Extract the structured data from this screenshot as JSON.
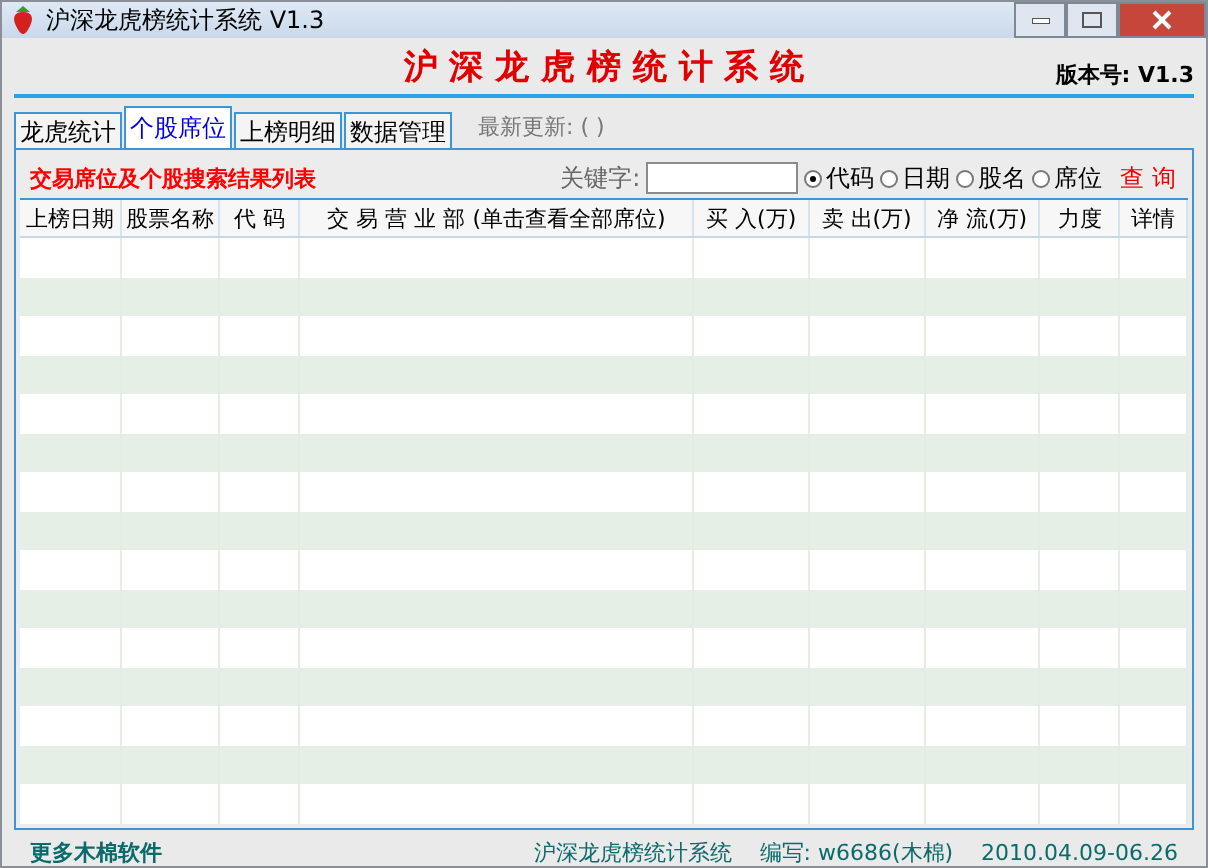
{
  "window": {
    "title": "沪深龙虎榜统计系统 V1.3"
  },
  "header": {
    "title": "沪 深 龙 虎 榜 统 计 系 统",
    "version": "版本号: V1.3"
  },
  "tabs": [
    {
      "label": "龙虎统计",
      "selected": false
    },
    {
      "label": "个股席位",
      "selected": true
    },
    {
      "label": "上榜明细",
      "selected": false
    },
    {
      "label": "数据管理",
      "selected": false
    }
  ],
  "last_update": "最新更新: ( )",
  "panel": {
    "heading": "交易席位及个股搜索结果列表",
    "keyword_label": "关键字:",
    "search_by": [
      {
        "label": "代码",
        "selected": true
      },
      {
        "label": "日期",
        "selected": false
      },
      {
        "label": "股名",
        "selected": false
      },
      {
        "label": "席位",
        "selected": false
      }
    ],
    "query_button": "查 询"
  },
  "table": {
    "columns": [
      "上榜日期",
      "股票名称",
      "代 码",
      "交 易 营 业 部 (单击查看全部席位)",
      "买 入(万)",
      "卖 出(万)",
      "净 流(万)",
      "力度",
      "详情"
    ]
  },
  "status_bar": {
    "link": "更多木棉软件",
    "app": "沪深龙虎榜统计系统",
    "author": "编写: w6686(木棉)",
    "dates": "2010.04.09-06.26"
  }
}
